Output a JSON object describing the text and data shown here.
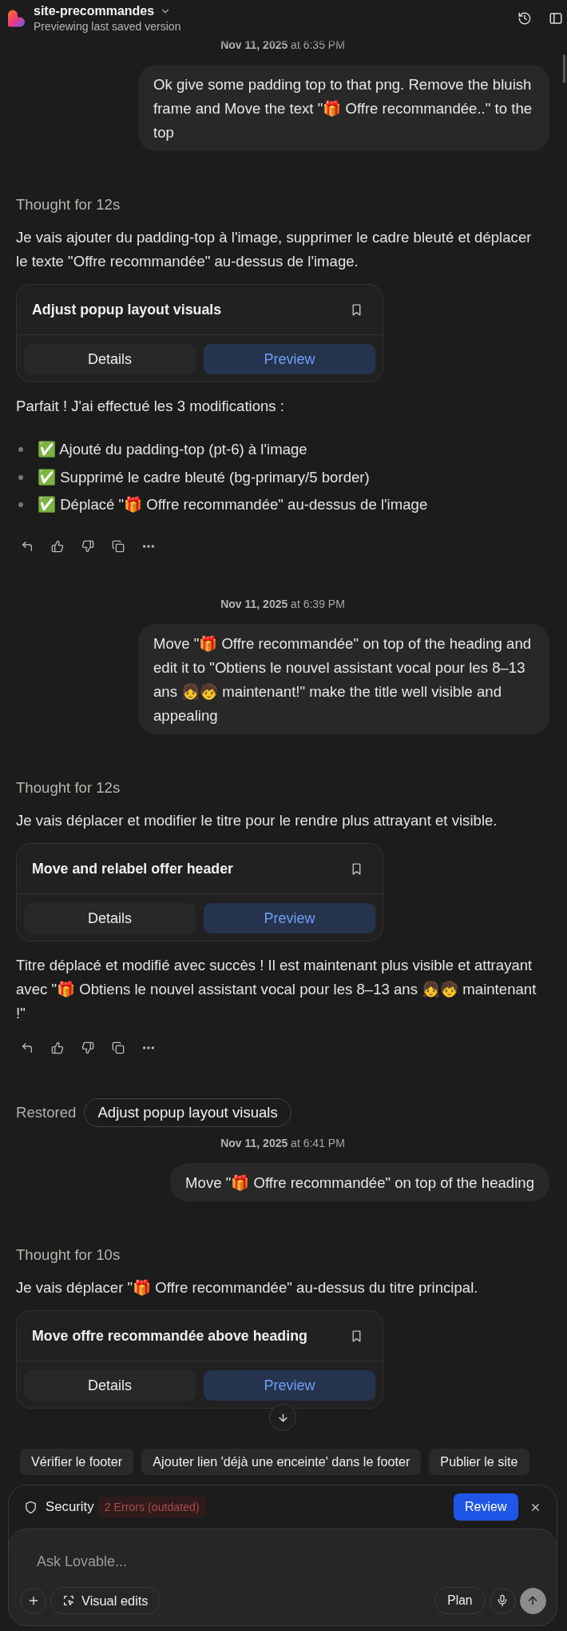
{
  "header": {
    "title": "site-precommandes",
    "subtitle": "Previewing last saved version"
  },
  "feed": [
    {
      "kind": "timestamp",
      "text": "**Nov 11, 2025** at 6:35 PM"
    },
    {
      "kind": "user",
      "text": "Ok give some padding top to that png. Remove the bluish frame and Move the text \"🎁 Offre recommandée..\" to the top"
    },
    {
      "kind": "thought",
      "text": "Thought for 12s"
    },
    {
      "kind": "text",
      "text": "Je vais ajouter du padding-top à l'image, supprimer le cadre bleuté et déplacer le texte \"Offre recommandée\" au-dessus de l'image."
    },
    {
      "kind": "card",
      "title": "Adjust popup layout visuals",
      "buttons": [
        {
          "label": "Details",
          "kind": "details"
        },
        {
          "label": "Preview",
          "kind": "preview"
        }
      ]
    },
    {
      "kind": "text",
      "text": "Parfait ! J'ai effectué les 3 modifications :"
    },
    {
      "kind": "list",
      "items": [
        "✅ Ajouté du padding-top (pt-6) à l'image",
        "✅ Supprimé le cadre bleuté (bg-primary/5 border)",
        "✅ Déplacé \"🎁 Offre recommandée\" au-dessus de l'image"
      ]
    },
    {
      "kind": "actions"
    },
    {
      "kind": "timestamp",
      "text": "**Nov 11, 2025** at 6:39 PM"
    },
    {
      "kind": "user",
      "text": "Move \"🎁 Offre recommandée\" on top of the heading and edit it to \"Obtiens le nouvel assistant vocal pour les 8–13 ans 👧🧒 maintenant!\" make the title well visible and appealing"
    },
    {
      "kind": "thought",
      "text": "Thought for 12s"
    },
    {
      "kind": "text",
      "text": "Je vais déplacer et modifier le titre pour le rendre plus attrayant et visible."
    },
    {
      "kind": "card",
      "title": "Move and relabel offer header",
      "buttons": [
        {
          "label": "Details",
          "kind": "details"
        },
        {
          "label": "Preview",
          "kind": "preview"
        }
      ]
    },
    {
      "kind": "text",
      "text": "Titre déplacé et modifié avec succès ! Il est maintenant plus visible et attrayant avec \"🎁 Obtiens le nouvel assistant vocal pour les 8–13 ans 👧🧒 maintenant !\""
    },
    {
      "kind": "actions"
    },
    {
      "kind": "restored",
      "label": "Restored",
      "version": "Adjust popup layout visuals"
    },
    {
      "kind": "timestamp",
      "text": "**Nov 11, 2025** at 6:41 PM"
    },
    {
      "kind": "user",
      "text": "Move \"🎁 Offre recommandée\" on top of the heading"
    },
    {
      "kind": "thought",
      "text": "Thought for 10s"
    },
    {
      "kind": "text",
      "text": "Je vais déplacer \"🎁 Offre recommandée\" au-dessus du titre principal."
    },
    {
      "kind": "card",
      "title": "Move offre recommandée above heading",
      "buttons": [
        {
          "label": "Details",
          "kind": "details"
        },
        {
          "label": "Preview",
          "kind": "preview"
        }
      ]
    }
  ],
  "suggestions": [
    "Vérifier le footer",
    "Ajouter lien 'déjà une enceinte' dans le footer",
    "Publier le site"
  ],
  "security": {
    "label": "Security",
    "badge": "2 Errors (outdated)",
    "button": "Review"
  },
  "composer": {
    "placeholder": "Ask Lovable...",
    "visual_edits": "Visual edits",
    "plan": "Plan"
  }
}
